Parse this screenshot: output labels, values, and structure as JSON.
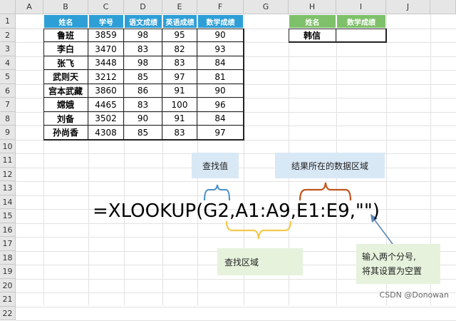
{
  "columns": [
    "A",
    "B",
    "C",
    "D",
    "E",
    "F",
    "G",
    "H",
    "I",
    "J"
  ],
  "rows": [
    "1",
    "2",
    "3",
    "4",
    "5",
    "6",
    "7",
    "8",
    "9",
    "10",
    "11",
    "12",
    "13",
    "14",
    "15",
    "16",
    "17",
    "18",
    "19",
    "20",
    "21",
    "22"
  ],
  "table1": {
    "headers": [
      "姓名",
      "学号",
      "语文成绩",
      "英语成绩",
      "数学成绩"
    ],
    "rows": [
      [
        "鲁班",
        "3859",
        "98",
        "95",
        "90"
      ],
      [
        "李白",
        "3470",
        "83",
        "82",
        "93"
      ],
      [
        "张飞",
        "3448",
        "98",
        "83",
        "84"
      ],
      [
        "武则天",
        "3212",
        "85",
        "97",
        "81"
      ],
      [
        "宫本武藏",
        "3860",
        "86",
        "91",
        "90"
      ],
      [
        "嫦娥",
        "4465",
        "83",
        "100",
        "96"
      ],
      [
        "刘备",
        "3502",
        "90",
        "91",
        "84"
      ],
      [
        "孙尚香",
        "4308",
        "85",
        "83",
        "97"
      ]
    ]
  },
  "table2": {
    "headers": [
      "姓名",
      "数学成绩"
    ],
    "row": [
      "韩信",
      ""
    ]
  },
  "formula": "=XLOOKUP(G2,A1:A9,E1:E9,\"\")",
  "callouts": {
    "lookup_value": "查找值",
    "result_range": "结果所在的数据区域",
    "lookup_range": "查找区域",
    "empty_line1": "输入两个分号,",
    "empty_line2": "将其设置为空置"
  },
  "watermark": "CSDN @Donowan",
  "colors": {
    "header_blue": "#2e9fd6",
    "header_green": "#7fc06a",
    "brace_blue": "#4a8fc7",
    "brace_orange": "#c0561e",
    "brace_yellow": "#f2c94c",
    "arrow_blue": "#5a86b5"
  }
}
